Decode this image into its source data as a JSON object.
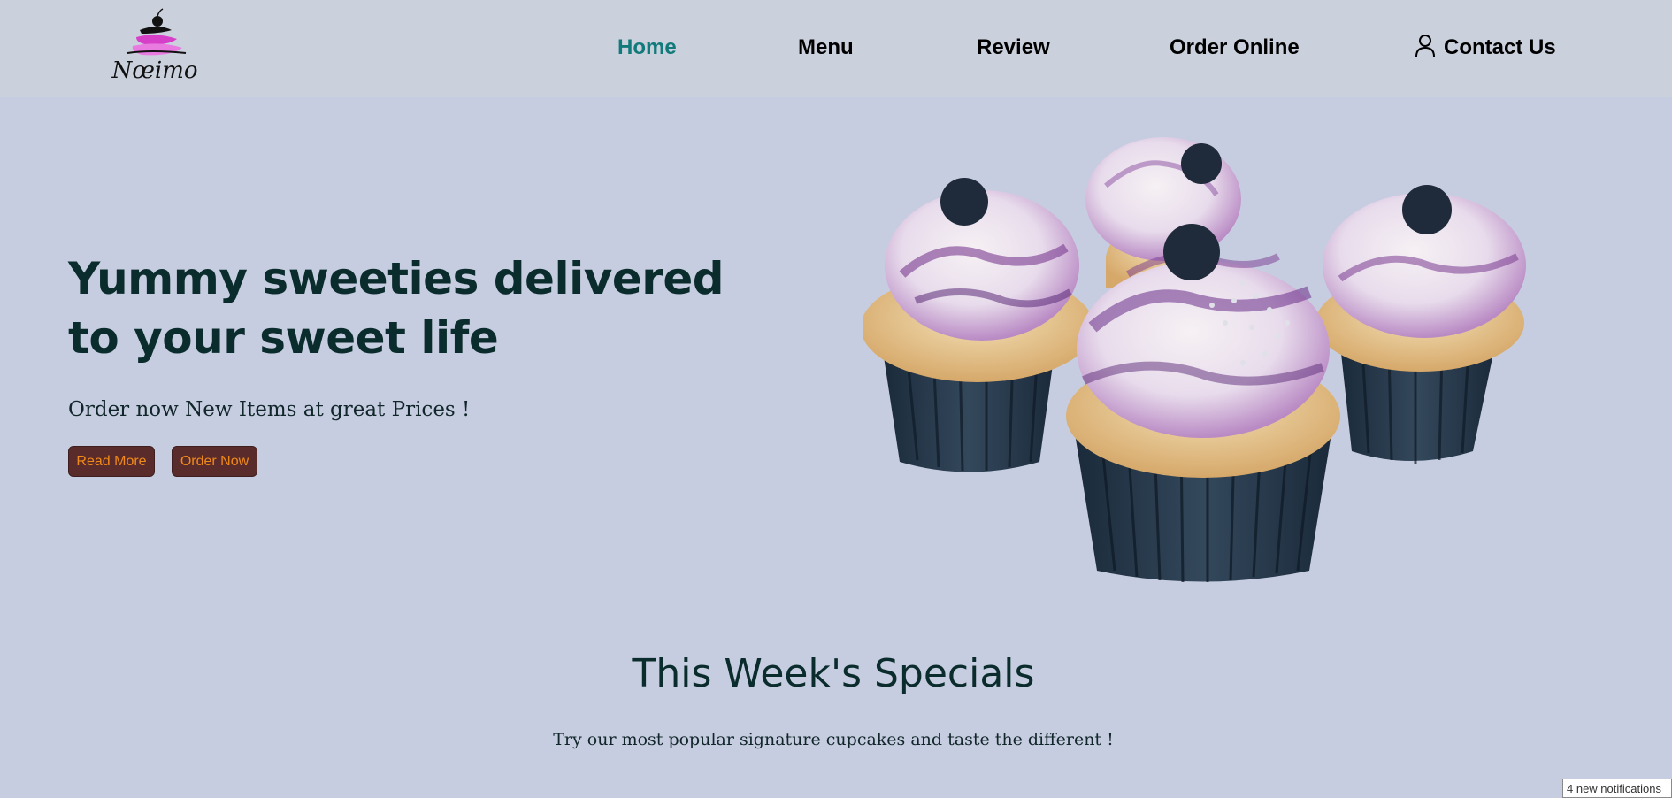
{
  "logo": {
    "text": "Nœimo",
    "icon": "cake-logo-icon"
  },
  "nav": {
    "items": [
      {
        "label": "Home",
        "active": true
      },
      {
        "label": "Menu",
        "active": false
      },
      {
        "label": "Review",
        "active": false
      },
      {
        "label": "Order Online",
        "active": false
      },
      {
        "label": "Contact Us",
        "active": false,
        "icon": "user-icon"
      }
    ]
  },
  "hero": {
    "title": "Yummy sweeties delivered to your sweet life",
    "subtitle": "Order now New Items at great Prices !",
    "buttons": {
      "read_more": "Read More",
      "order_now": "Order Now"
    },
    "image": "blueberry-cupcakes-image"
  },
  "specials": {
    "title": "This Week's Specials",
    "subtitle": "Try our most popular signature cupcakes and taste the different !"
  },
  "notification": {
    "text": "4 new notifications"
  },
  "colors": {
    "background": "#c7cde0",
    "header": "#cbd0dd",
    "active_nav": "#127a7a",
    "heading": "#0b2c2c",
    "button_bg": "#5a2b2b",
    "button_text": "#f08a1a"
  }
}
